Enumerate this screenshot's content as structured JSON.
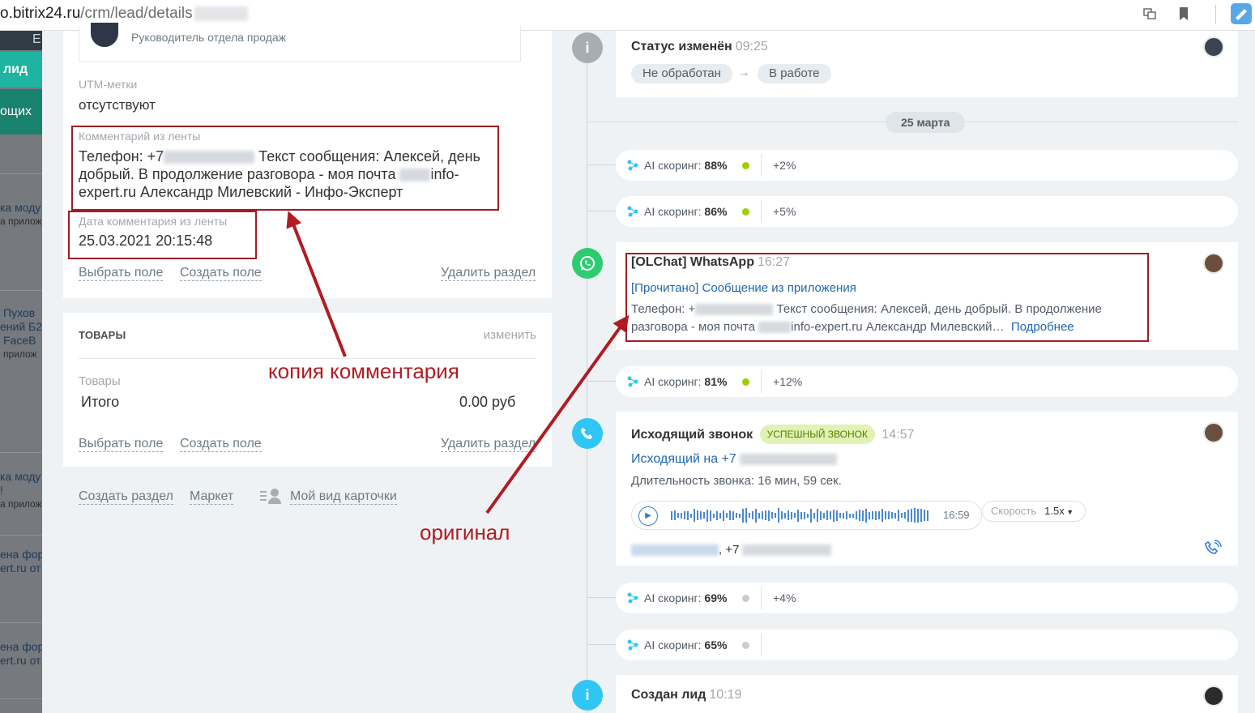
{
  "browser": {
    "url_host": "o.bitrix24.ru",
    "url_path": "/crm/lead/details",
    "icons": [
      "translate-icon",
      "bookmark-icon",
      "extension-icon"
    ]
  },
  "sidebar": {
    "top_letter": "E",
    "lead_label": "лид",
    "tab_label": "ощих",
    "items": [
      {
        "title": "ка моду",
        "sub": "а прилож"
      },
      {
        "title": "Пухов",
        "line2": "ений Б2",
        "line3": "FaceB",
        "sub": "прилож"
      },
      {
        "title": "ка моду",
        "line2": "!",
        "sub": "а прилож"
      },
      {
        "title": "ена фор",
        "line2": "ert.ru от"
      },
      {
        "title": "ена фор",
        "line2": "ert.ru от"
      }
    ]
  },
  "lead_card": {
    "user_role": "Руководитель отдела продаж",
    "utm_label": "UTM-метки",
    "utm_value": "отсутствуют",
    "comment_label": "Комментарий из ленты",
    "comment_text_1": "Телефон: +7",
    "comment_text_2": " Текст сообщения: Алексей, день",
    "comment_text_3": "добрый. В продолжение разговора - моя почта ",
    "comment_text_4": "info-",
    "comment_text_5": "expert.ru Александр Милевский - Инфо-Эксперт",
    "date_label": "Дата комментария из ленты",
    "date_value": "25.03.2021 20:15:48",
    "select_field": "Выбрать поле",
    "create_field": "Создать поле",
    "delete_section": "Удалить раздел"
  },
  "goods_card": {
    "title": "ТОВАРЫ",
    "edit": "изменить",
    "goods_label": "Товары",
    "total_label": "Итого",
    "total_value": "0.00 руб",
    "select_field": "Выбрать поле",
    "create_field": "Создать поле",
    "delete_section": "Удалить раздел"
  },
  "bottom_links": {
    "create_section": "Создать раздел",
    "market": "Маркет",
    "my_view": "Мой вид карточки"
  },
  "annotations": {
    "copy": "копия комментария",
    "original": "оригинал"
  },
  "timeline": {
    "status": {
      "title": "Статус изменён",
      "time": "09:25",
      "from": "Не обработан",
      "arrow": "→",
      "to": "В работе"
    },
    "date_separator": "25 марта",
    "ai_label": "AI скоринг:",
    "ai_rows": [
      {
        "value": "88%",
        "delta": "+2%",
        "dot": "#9dcf00"
      },
      {
        "value": "86%",
        "delta": "+5%",
        "dot": "#9dcf00"
      },
      {
        "value": "81%",
        "delta": "+12%",
        "dot": "#9dcf00"
      },
      {
        "value": "69%",
        "delta": "+4%",
        "dot": "#c8cdd1"
      },
      {
        "value": "65%",
        "delta": "",
        "dot": "#c8cdd1"
      }
    ],
    "whatsapp": {
      "title": "[OLChat] WhatsApp",
      "time": "16:27",
      "link": "[Прочитано] Сообщение из приложения",
      "text_1a": "Телефон: +",
      "text_1b": " Текст сообщения: Алексей, день добрый. В продолжение",
      "text_2a": "разговора - моя почта ",
      "text_2b": "info-expert.ru Александр Милевский…",
      "more": "Подробнее"
    },
    "call": {
      "title": "Исходящий звонок",
      "badge": "успешный звонок",
      "time": "14:57",
      "outgoing": "Исходящий на +7",
      "duration": "Длительность звонка: 16 мин, 59 сек.",
      "player_time": "16:59",
      "speed_label": "Скорость",
      "speed_value": "1.5x",
      "contact_suffix": ", +7"
    },
    "created": {
      "title": "Создан лид",
      "time": "10:19"
    },
    "colors": {
      "info_icon": "#a8adb4",
      "whatsapp_icon": "#2ecc71",
      "call_icon": "#2fc6f6",
      "badge_bg": "#e2f1b4",
      "badge_text": "#5a7d00",
      "annotation": "#b01c22"
    }
  }
}
